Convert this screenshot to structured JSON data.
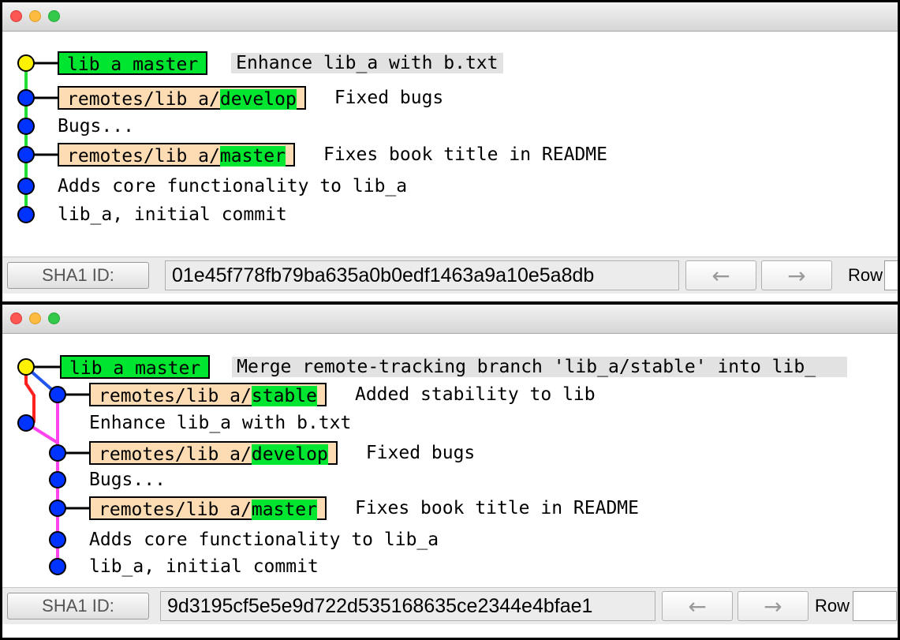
{
  "top_window": {
    "commits": [
      {
        "local_ref": "lib_a_master",
        "message": "Enhance lib_a with b.txt"
      },
      {
        "remote_prefix": "remotes/lib_a/",
        "remote_branch": "develop",
        "message": "Fixed bugs"
      },
      {
        "message": "Bugs..."
      },
      {
        "remote_prefix": "remotes/lib_a/",
        "remote_branch": "master",
        "message": "Fixes book title in README"
      },
      {
        "message": "Adds core functionality to lib_a"
      },
      {
        "message": "lib_a, initial commit"
      }
    ],
    "toolbar": {
      "sha_label": "SHA1 ID:",
      "sha_value": "01e45f778fb79ba635a0b0edf1463a9a10e5a8db",
      "prev": "←",
      "next": "→",
      "row_label": "Row"
    }
  },
  "bottom_window": {
    "commits": [
      {
        "local_ref": "lib_a_master",
        "message": "Merge remote-tracking branch 'lib_a/stable' into lib_"
      },
      {
        "remote_prefix": "remotes/lib_a/",
        "remote_branch": "stable",
        "message": "Added stability to lib"
      },
      {
        "message": "Enhance lib_a with b.txt"
      },
      {
        "remote_prefix": "remotes/lib_a/",
        "remote_branch": "develop",
        "message": "Fixed bugs"
      },
      {
        "message": "Bugs..."
      },
      {
        "remote_prefix": "remotes/lib_a/",
        "remote_branch": "master",
        "message": "Fixes book title in README"
      },
      {
        "message": "Adds core functionality to lib_a"
      },
      {
        "message": "lib_a, initial commit"
      }
    ],
    "toolbar": {
      "sha_label": "SHA1 ID:",
      "sha_value": "9d3195cf5e5e9d722d535168635ce2344e4bfae1",
      "prev": "←",
      "next": "→",
      "row_label": "Row"
    }
  },
  "colors": {
    "local_ref_bg": "#00e52f",
    "remote_ref_bg": "#fddcb4",
    "head_node": "#fff200",
    "commit_node": "#0033ff",
    "line_green": "#22dd33",
    "line_red": "#ff2020",
    "line_pink": "#ff44ee",
    "line_blue": "#2255ee"
  }
}
